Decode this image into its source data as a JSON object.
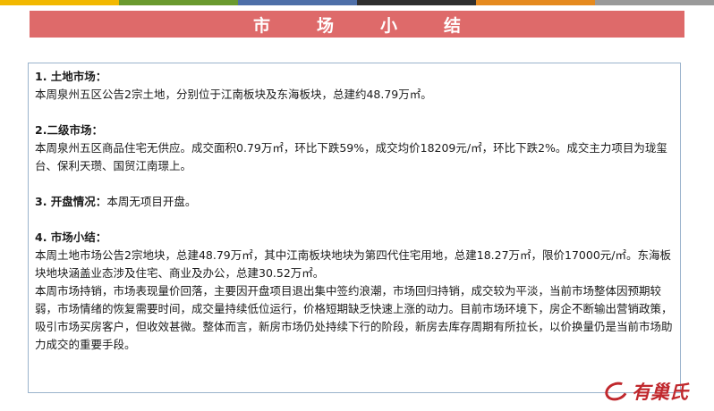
{
  "stripe_colors": [
    "#f2b800",
    "#6a9a2f",
    "#4e6fa8",
    "#2f2f2f",
    "#e58a1f",
    "#9a9a9a"
  ],
  "title": "市场小结",
  "sections": {
    "land": {
      "heading": "1. 土地市场：",
      "text": "本周泉州五区公告2宗土地，分别位于江南板块及东海板块，总建约48.79万㎡。"
    },
    "secondary": {
      "heading": "2.二级市场：",
      "text": "本周泉州五区商品住宅无供应。成交面积0.79万㎡，环比下跌59%，成交均价18209元/㎡，环比下跌2%。成交主力项目为珑玺台、保利天瓒、国贸江南璟上。"
    },
    "opening": {
      "label": "3. 开盘情况：",
      "text": "本周无项目开盘。"
    },
    "summary": {
      "heading": "4. 市场小结：",
      "para1": "本周土地市场公告2宗地块，总建48.79万㎡，其中江南板块地块为第四代住宅用地，总建18.27万㎡，限价17000元/㎡。东海板块地块涵盖业态涉及住宅、商业及办公，总建30.52万㎡。",
      "para2": "本周市场持销，市场表现量价回落，主要因开盘项目退出集中签约浪潮，市场回归持销，成交较为平淡，当前市场整体因预期较弱，市场情绪的恢复需要时间，成交量持续低位运行，价格短期缺乏快速上涨的动力。目前市场环境下，房企不断输出营销政策，吸引市场买房客户，但收效甚微。整体而言，新房市场仍处持续下行的阶段，新房去库存周期有所拉长，以价换量仍是当前市场助力成交的重要手段。"
    }
  },
  "logo": {
    "text": "有巢氏",
    "color": "#c0282d"
  },
  "colors": {
    "title_bar": "#de6a6a",
    "box_border": "#9ab3cc"
  }
}
